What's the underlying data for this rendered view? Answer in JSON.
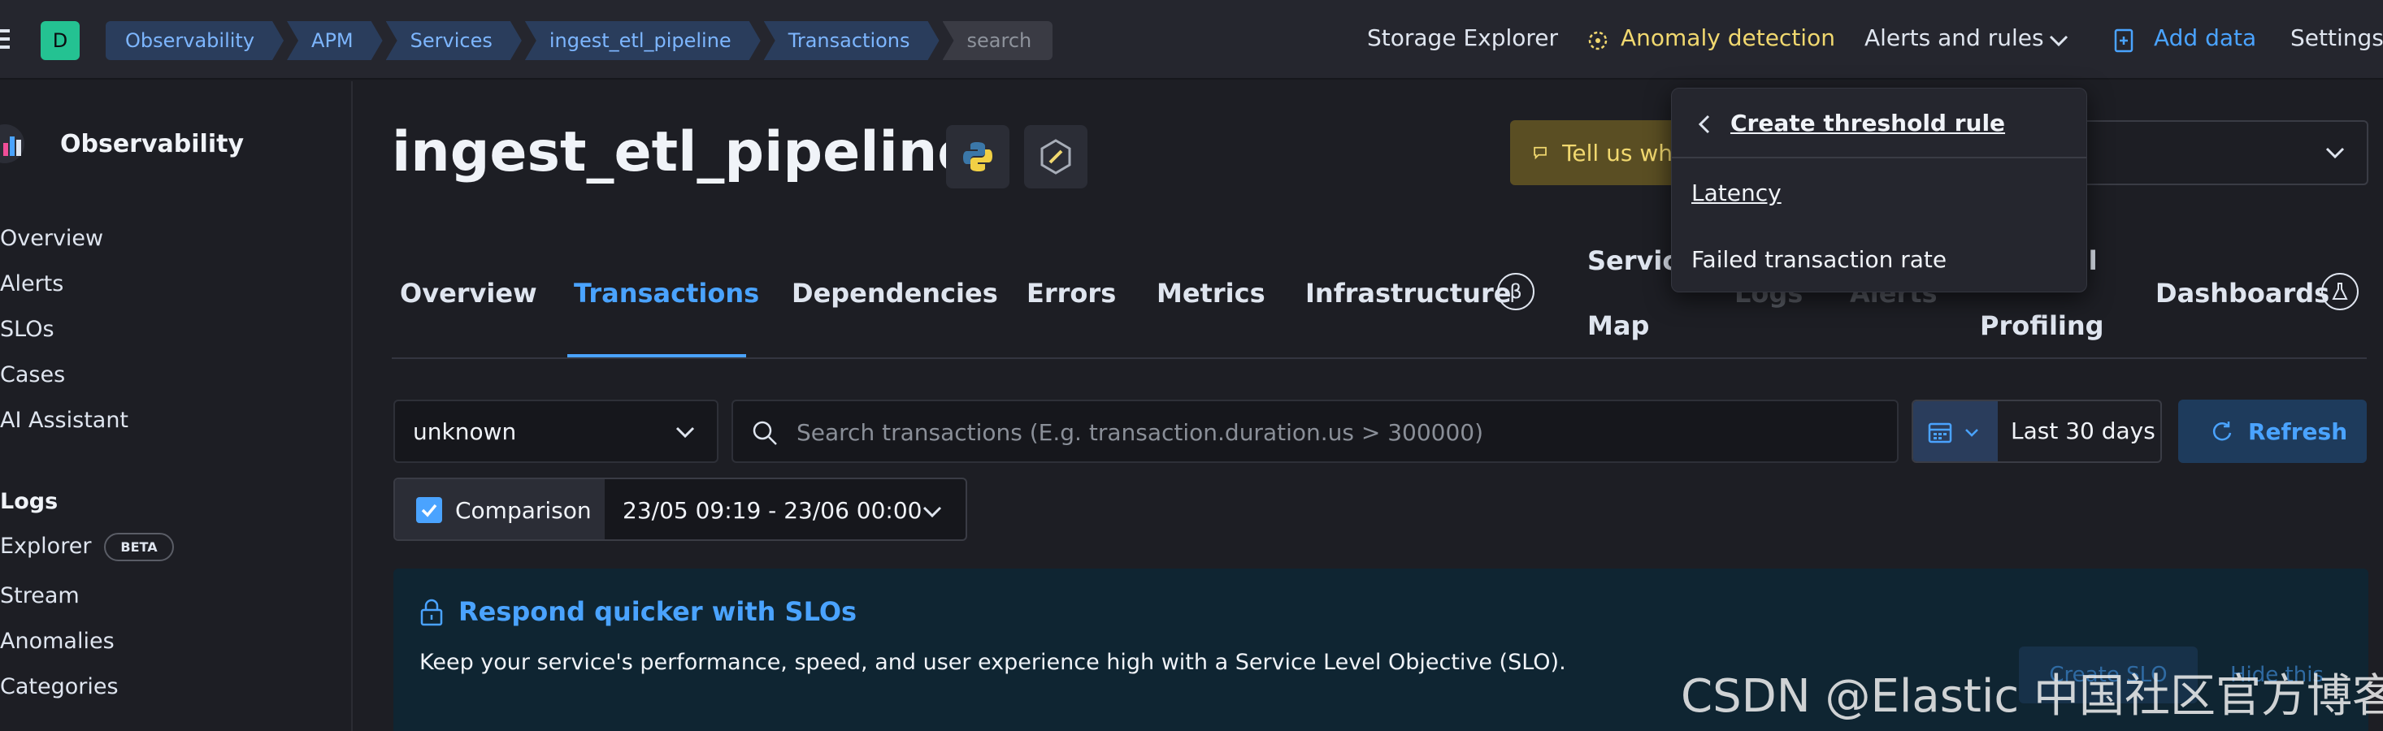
{
  "header": {
    "app_initial": "D",
    "breadcrumbs": [
      "Observability",
      "APM",
      "Services",
      "ingest_etl_pipeline",
      "Transactions",
      "search"
    ],
    "storage_explorer": "Storage Explorer",
    "anomaly_detection": "Anomaly detection",
    "alerts_and_rules": "Alerts and rules",
    "add_data": "Add data",
    "settings": "Settings"
  },
  "sidebar": {
    "title": "Observability",
    "items": [
      "Overview",
      "Alerts",
      "SLOs",
      "Cases",
      "AI Assistant"
    ],
    "logs_section": "Logs",
    "logs_items": [
      "Explorer",
      "Stream",
      "Anomalies",
      "Categories"
    ],
    "beta_label": "BETA"
  },
  "service": {
    "title": "ingest_etl_pipeline",
    "feedback": "Tell us wh"
  },
  "tabs": {
    "overview": "Overview",
    "transactions": "Transactions",
    "dependencies": "Dependencies",
    "errors": "Errors",
    "metrics": "Metrics",
    "infrastructure": "Infrastructure",
    "beta_symbol": "β",
    "service_map_1": "Service",
    "service_map_2": "Map",
    "logs": "Logs",
    "alerts": "Alerts",
    "profiling_1": "al",
    "profiling_2": "Profiling",
    "dashboards": "Dashboards"
  },
  "filters": {
    "transaction_type": "unknown",
    "search_placeholder": "Search transactions (E.g. transaction.duration.us > 300000)",
    "date_range": "Last 30 days",
    "refresh": "Refresh",
    "comparison_label": "Comparison",
    "comparison_checked": true,
    "comparison_range": "23/05 09:19 - 23/06 00:00"
  },
  "callout": {
    "title": "Respond quicker with SLOs",
    "text": "Keep your service's performance, speed, and user experience high with a Service Level Objective (SLO).",
    "create_button": "Create SLO",
    "hide_link": "Hide this"
  },
  "popover": {
    "title": "Create threshold rule",
    "items": [
      "Latency",
      "Failed transaction rate"
    ]
  },
  "watermark": "CSDN @Elastic 中国社区官方博客",
  "colors": {
    "accent": "#4aa3ff",
    "badge": "#24c292",
    "anomaly": "#f1d86f"
  }
}
